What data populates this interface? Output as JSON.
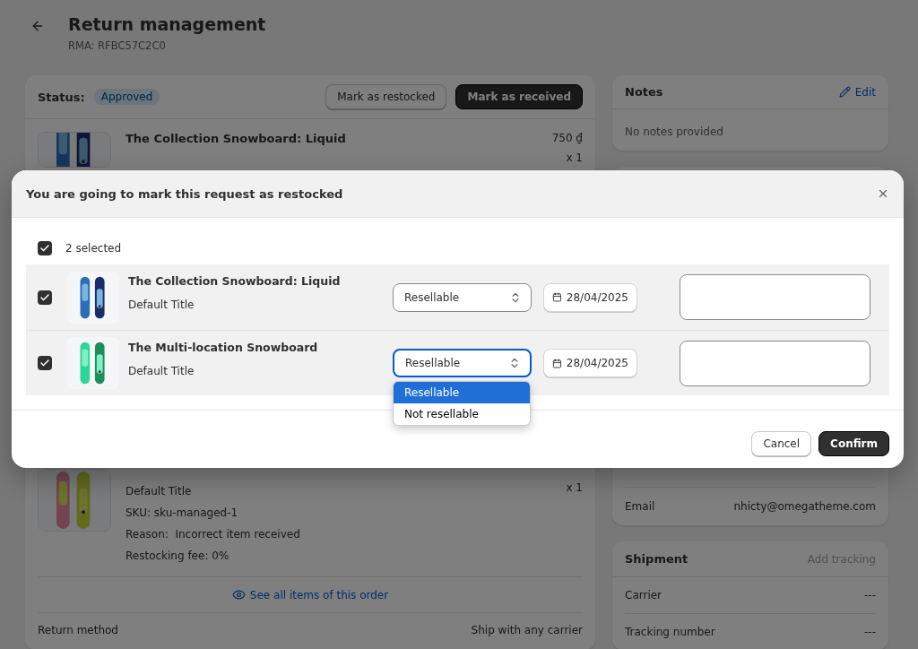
{
  "header": {
    "title": "Return management",
    "rma": "RMA: RFBC57C2C0"
  },
  "return_card": {
    "status_label": "Status:",
    "status": "Approved",
    "actions": [
      {
        "label": "Mark as restocked",
        "kind": "secondary"
      },
      {
        "label": "Mark as received",
        "kind": "primary"
      }
    ],
    "first_item": {
      "name": "The Collection Snowboard: Liquid",
      "price": "750 ₫",
      "quantity": "x 1"
    },
    "lower_item": {
      "quantity": "x 1",
      "details": [
        "Default Title",
        "SKU: sku-managed-1",
        "Reason:  Incorrect item received",
        "Restocking fee: 0%"
      ]
    },
    "see_all": "See all items of this order",
    "return_method": {
      "label": "Return method",
      "value": "Ship with any carrier"
    }
  },
  "notes": {
    "title": "Notes",
    "edit": "Edit",
    "text": "No notes provided"
  },
  "customer": {
    "rows": [
      {
        "label": "Email",
        "value": "nhicty@omegatheme.com"
      }
    ]
  },
  "shipment": {
    "title": "Shipment",
    "action": "Add tracking",
    "rows": [
      {
        "label": "Carrier",
        "value": "---"
      },
      {
        "label": "Tracking number",
        "value": "---"
      }
    ]
  },
  "modal": {
    "title": "You are going to mark this request as restocked",
    "select_all": {
      "label": "2 selected",
      "checked": true
    },
    "rows": [
      {
        "name": "The Collection Snowboard: Liquid",
        "variant": "Default Title",
        "checked": true,
        "condition": "Resellable",
        "focused": false,
        "date": "28/04/2025"
      },
      {
        "name": "The Multi-location Snowboard",
        "variant": "Default Title",
        "checked": true,
        "condition": "Resellable",
        "focused": true,
        "date": "28/04/2025"
      }
    ],
    "dropdown": {
      "options": [
        {
          "label": "Resellable",
          "selected": true
        },
        {
          "label": "Not resellable",
          "selected": false
        }
      ]
    },
    "buttons": [
      {
        "label": "Cancel",
        "kind": "secondary"
      },
      {
        "label": "Confirm",
        "kind": "primary"
      }
    ]
  }
}
